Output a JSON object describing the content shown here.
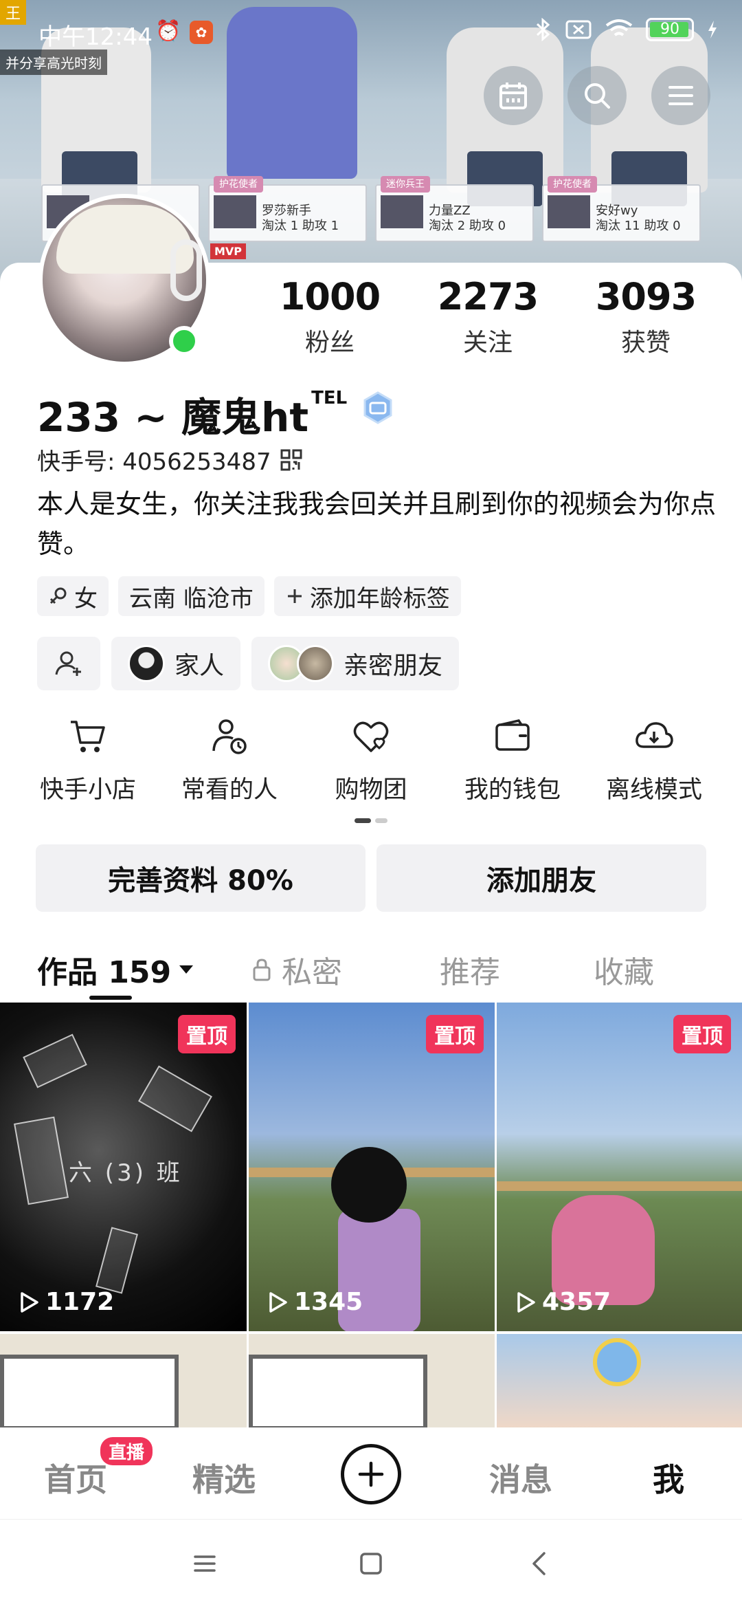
{
  "status_bar": {
    "time": "中午12:44",
    "battery": "90"
  },
  "banner": {
    "corner_tag": "王",
    "corner_text": "并分享高光时刻",
    "mvp": "MVP",
    "cards": [
      {
        "role": "",
        "name": "",
        "stats": ""
      },
      {
        "role": "护花使者",
        "name": "罗莎新手",
        "stats": "淘汰 1  助攻 1"
      },
      {
        "role": "迷你兵王",
        "name": "力量ZZ",
        "stats": "淘汰 2  助攻 0"
      },
      {
        "role": "护花使者",
        "name": "安好wy",
        "stats": "淘汰 11  助攻 0"
      }
    ]
  },
  "profile": {
    "stats": [
      {
        "num": "1000",
        "label": "粉丝"
      },
      {
        "num": "2273",
        "label": "关注"
      },
      {
        "num": "3093",
        "label": "获赞"
      }
    ],
    "name": "233 ~ 魔鬼ht",
    "name_sup": "TEL",
    "kuaishou_id": "快手号: 4056253487",
    "bio": "本人是女生，你关注我我会回关并且刷到你的视频会为你点赞。",
    "tags": [
      "女",
      "云南 临沧市",
      "添加年龄标签"
    ],
    "friend_chips": [
      "家人",
      "亲密朋友"
    ]
  },
  "shortcuts": [
    {
      "label": "快手小店",
      "icon": "cart-icon"
    },
    {
      "label": "常看的人",
      "icon": "person-clock-icon"
    },
    {
      "label": "购物团",
      "icon": "heart-group-icon"
    },
    {
      "label": "我的钱包",
      "icon": "wallet-icon"
    },
    {
      "label": "离线模式",
      "icon": "cloud-download-icon"
    }
  ],
  "actions": {
    "complete_profile": "完善资料 80%",
    "add_friend": "添加朋友"
  },
  "tabs": {
    "works": "作品 159",
    "private": "私密",
    "recommend": "推荐",
    "favorites": "收藏"
  },
  "videos": [
    {
      "pinned": "置顶",
      "plays": "1172",
      "caption": "六 (3) 班"
    },
    {
      "pinned": "置顶",
      "plays": "1345"
    },
    {
      "pinned": "置顶",
      "plays": "4357"
    }
  ],
  "bottom_nav": {
    "home": "首页",
    "live": "直播",
    "featured": "精选",
    "messages": "消息",
    "me": "我"
  }
}
